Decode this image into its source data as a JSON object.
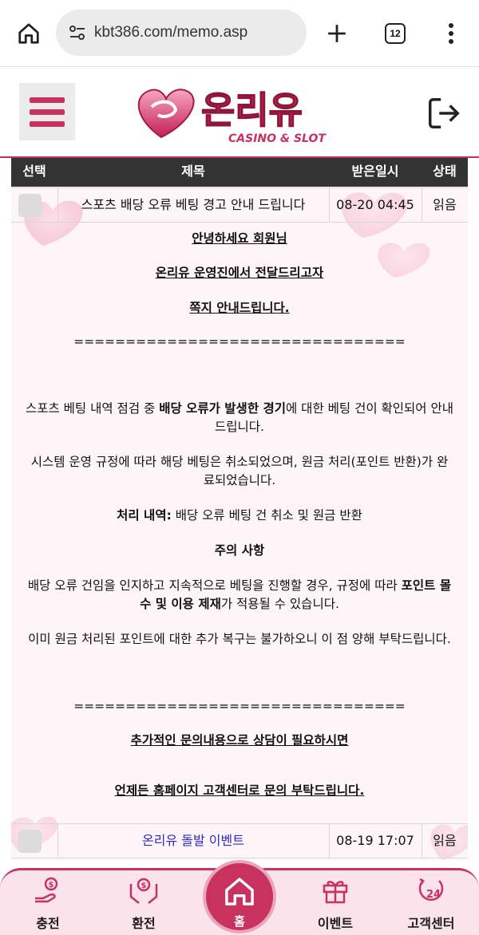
{
  "browser": {
    "url": "kbt386.com/memo.asp",
    "tab_count": "12"
  },
  "header": {
    "logo_text": "온리유",
    "logo_sub": "CASINO & SLOT"
  },
  "table": {
    "headers": {
      "select": "선택",
      "subject": "제목",
      "date": "받은일시",
      "status": "상태"
    },
    "rows": [
      {
        "subject": "스포츠 배당 오류 베팅 경고 안내 드립니다",
        "date": "08-20 04:45",
        "status": "읽음"
      },
      {
        "subject": "온리유 돌발 이벤트",
        "date": "08-19 17:07",
        "status": "읽음"
      }
    ]
  },
  "memo": {
    "greeting1": "안녕하세요 회원님",
    "greeting2": "온리유 운영진에서 전달드리고자",
    "greeting3": "쪽지 안내드립니다.",
    "divider": "================================",
    "p1_a": "스포츠 베팅 내역 점검 중 ",
    "p1_b": "배당 오류가 발생한 경기",
    "p1_c": "에 대한 베팅 건이 확인되어 안내",
    "p1_d": "드립니다.",
    "p2_line1": "시스템 운영 규정에 따라 해당 베팅은 취소되었으며, 원금 처리(포인트 반환)가 완",
    "p2_line2": "료되었습니다.",
    "p3_label": "처리 내역:",
    "p3_text": " 배당 오류 베팅 건 취소 및 원금 반환",
    "p4_title": "주의 사항",
    "p5_a": "배당 오류 건임을 인지하고 지속적으로 베팅을 진행할 경우, 규정에 따라 ",
    "p5_b": "포인트 몰",
    "p5_c": "수 및 이용 제재",
    "p5_d": "가 적용될 수 있습니다.",
    "p6": "이미 원금 처리된 포인트에 대한 추가 복구는 불가하오니 이 점 양해 부탁드립니다.",
    "closing1": "추가적인 문의내용으로 상담이 필요하시면 ",
    "closing2": "언제든 홈페이지 고객센터로 문의 부탁드립니다."
  },
  "bottom_nav": {
    "items": [
      {
        "label": "충전"
      },
      {
        "label": "환전"
      },
      {
        "label": "홈"
      },
      {
        "label": "이벤트"
      },
      {
        "label": "고객센터"
      }
    ]
  },
  "colors": {
    "accent": "#c8325e",
    "header_dark": "#333333",
    "link": "#2b2bc4"
  }
}
